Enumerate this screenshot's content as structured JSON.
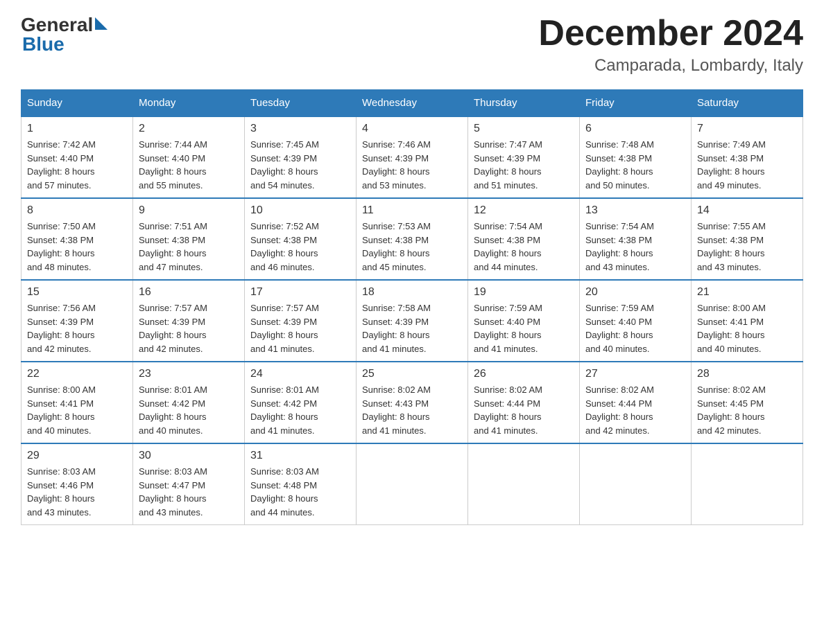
{
  "header": {
    "logo_general": "General",
    "logo_blue": "Blue",
    "month_title": "December 2024",
    "location": "Camparada, Lombardy, Italy"
  },
  "days_of_week": [
    "Sunday",
    "Monday",
    "Tuesday",
    "Wednesday",
    "Thursday",
    "Friday",
    "Saturday"
  ],
  "weeks": [
    [
      {
        "day": "1",
        "sunrise": "7:42 AM",
        "sunset": "4:40 PM",
        "daylight": "8 hours and 57 minutes."
      },
      {
        "day": "2",
        "sunrise": "7:44 AM",
        "sunset": "4:40 PM",
        "daylight": "8 hours and 55 minutes."
      },
      {
        "day": "3",
        "sunrise": "7:45 AM",
        "sunset": "4:39 PM",
        "daylight": "8 hours and 54 minutes."
      },
      {
        "day": "4",
        "sunrise": "7:46 AM",
        "sunset": "4:39 PM",
        "daylight": "8 hours and 53 minutes."
      },
      {
        "day": "5",
        "sunrise": "7:47 AM",
        "sunset": "4:39 PM",
        "daylight": "8 hours and 51 minutes."
      },
      {
        "day": "6",
        "sunrise": "7:48 AM",
        "sunset": "4:38 PM",
        "daylight": "8 hours and 50 minutes."
      },
      {
        "day": "7",
        "sunrise": "7:49 AM",
        "sunset": "4:38 PM",
        "daylight": "8 hours and 49 minutes."
      }
    ],
    [
      {
        "day": "8",
        "sunrise": "7:50 AM",
        "sunset": "4:38 PM",
        "daylight": "8 hours and 48 minutes."
      },
      {
        "day": "9",
        "sunrise": "7:51 AM",
        "sunset": "4:38 PM",
        "daylight": "8 hours and 47 minutes."
      },
      {
        "day": "10",
        "sunrise": "7:52 AM",
        "sunset": "4:38 PM",
        "daylight": "8 hours and 46 minutes."
      },
      {
        "day": "11",
        "sunrise": "7:53 AM",
        "sunset": "4:38 PM",
        "daylight": "8 hours and 45 minutes."
      },
      {
        "day": "12",
        "sunrise": "7:54 AM",
        "sunset": "4:38 PM",
        "daylight": "8 hours and 44 minutes."
      },
      {
        "day": "13",
        "sunrise": "7:54 AM",
        "sunset": "4:38 PM",
        "daylight": "8 hours and 43 minutes."
      },
      {
        "day": "14",
        "sunrise": "7:55 AM",
        "sunset": "4:38 PM",
        "daylight": "8 hours and 43 minutes."
      }
    ],
    [
      {
        "day": "15",
        "sunrise": "7:56 AM",
        "sunset": "4:39 PM",
        "daylight": "8 hours and 42 minutes."
      },
      {
        "day": "16",
        "sunrise": "7:57 AM",
        "sunset": "4:39 PM",
        "daylight": "8 hours and 42 minutes."
      },
      {
        "day": "17",
        "sunrise": "7:57 AM",
        "sunset": "4:39 PM",
        "daylight": "8 hours and 41 minutes."
      },
      {
        "day": "18",
        "sunrise": "7:58 AM",
        "sunset": "4:39 PM",
        "daylight": "8 hours and 41 minutes."
      },
      {
        "day": "19",
        "sunrise": "7:59 AM",
        "sunset": "4:40 PM",
        "daylight": "8 hours and 41 minutes."
      },
      {
        "day": "20",
        "sunrise": "7:59 AM",
        "sunset": "4:40 PM",
        "daylight": "8 hours and 40 minutes."
      },
      {
        "day": "21",
        "sunrise": "8:00 AM",
        "sunset": "4:41 PM",
        "daylight": "8 hours and 40 minutes."
      }
    ],
    [
      {
        "day": "22",
        "sunrise": "8:00 AM",
        "sunset": "4:41 PM",
        "daylight": "8 hours and 40 minutes."
      },
      {
        "day": "23",
        "sunrise": "8:01 AM",
        "sunset": "4:42 PM",
        "daylight": "8 hours and 40 minutes."
      },
      {
        "day": "24",
        "sunrise": "8:01 AM",
        "sunset": "4:42 PM",
        "daylight": "8 hours and 41 minutes."
      },
      {
        "day": "25",
        "sunrise": "8:02 AM",
        "sunset": "4:43 PM",
        "daylight": "8 hours and 41 minutes."
      },
      {
        "day": "26",
        "sunrise": "8:02 AM",
        "sunset": "4:44 PM",
        "daylight": "8 hours and 41 minutes."
      },
      {
        "day": "27",
        "sunrise": "8:02 AM",
        "sunset": "4:44 PM",
        "daylight": "8 hours and 42 minutes."
      },
      {
        "day": "28",
        "sunrise": "8:02 AM",
        "sunset": "4:45 PM",
        "daylight": "8 hours and 42 minutes."
      }
    ],
    [
      {
        "day": "29",
        "sunrise": "8:03 AM",
        "sunset": "4:46 PM",
        "daylight": "8 hours and 43 minutes."
      },
      {
        "day": "30",
        "sunrise": "8:03 AM",
        "sunset": "4:47 PM",
        "daylight": "8 hours and 43 minutes."
      },
      {
        "day": "31",
        "sunrise": "8:03 AM",
        "sunset": "4:48 PM",
        "daylight": "8 hours and 44 minutes."
      },
      null,
      null,
      null,
      null
    ]
  ]
}
